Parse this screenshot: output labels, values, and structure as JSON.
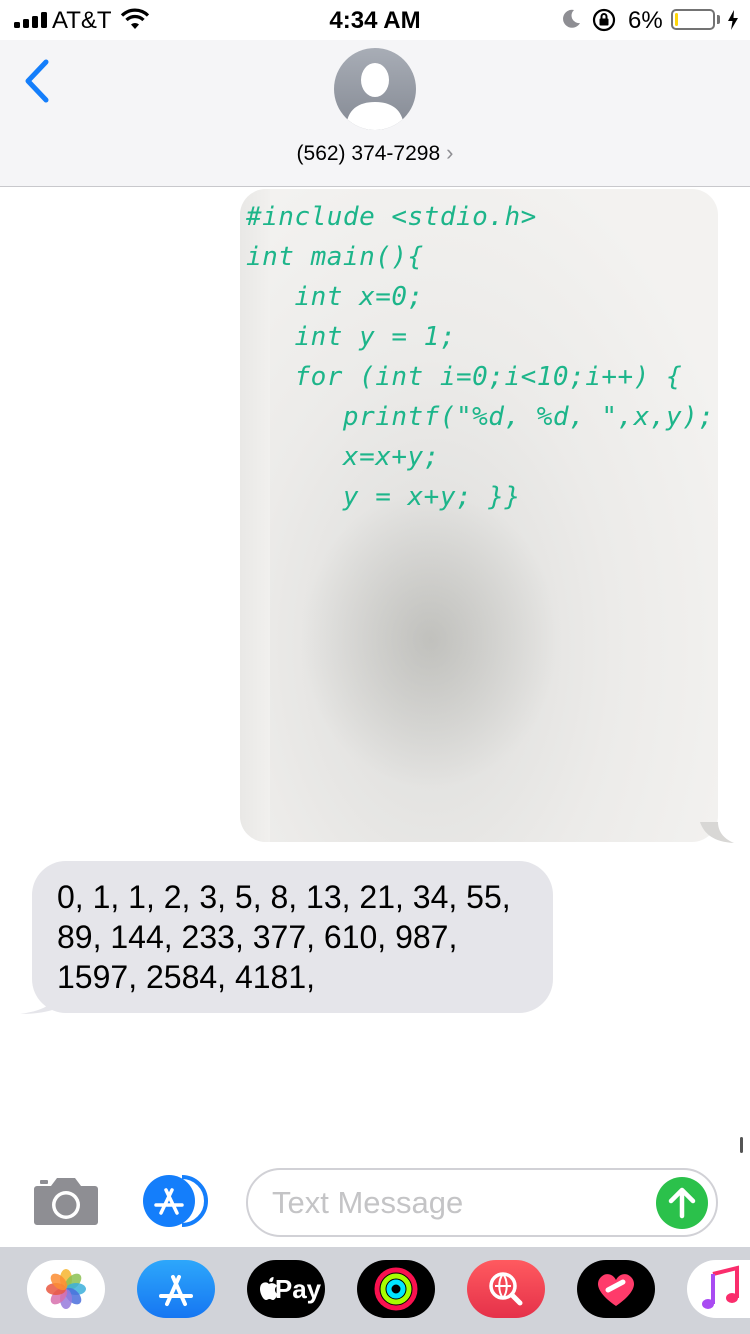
{
  "status_bar": {
    "carrier": "AT&T",
    "time": "4:34 AM",
    "battery_percent": "6%",
    "battery_level": 0.06,
    "signal_bars": 4
  },
  "header": {
    "contact": "(562) 374-7298",
    "contact_chevron": "›"
  },
  "messages": {
    "image_code_lines": [
      "#include <stdio.h>",
      "int main(){",
      "   int x=0;",
      "   int y = 1;",
      "   for (int i=0;i<10;i++) {",
      "      printf(\"%d, %d, \",x,y);",
      "      x=x+y;",
      "      y = x+y; }}"
    ],
    "received_text": "0, 1, 1, 2, 3, 5, 8, 13, 21, 34, 55, 89, 144, 233, 377, 610, 987, 1597, 2584, 4181,"
  },
  "input_bar": {
    "placeholder": "Text Message"
  },
  "app_drawer": {
    "apple_pay_label": "Pay",
    "apps": [
      "photos-icon",
      "app-store-icon",
      "apple-pay-icon",
      "activity-icon",
      "web-search-icon",
      "heart-sticker-icon",
      "music-icon"
    ]
  },
  "colors": {
    "accent_blue": "#147efb",
    "send_green": "#2bc14b",
    "received_bubble": "#e5e5ea",
    "battery_low": "#ffd60a",
    "marker_green": "#1db58a"
  }
}
